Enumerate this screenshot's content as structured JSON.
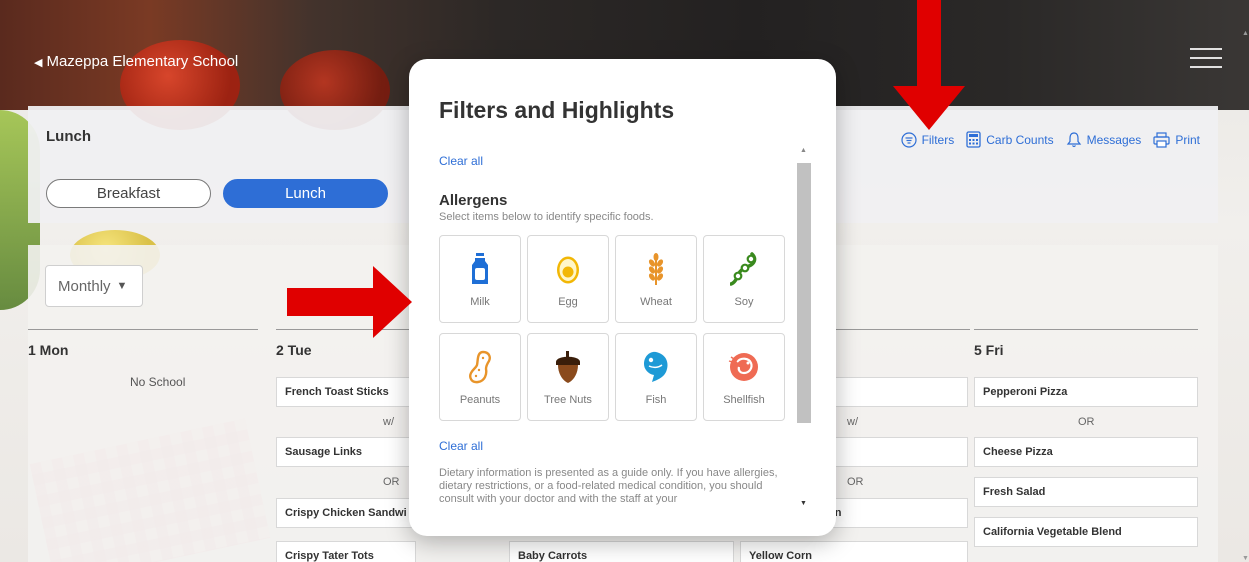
{
  "header": {
    "back_label": "Mazeppa Elementary School"
  },
  "meal": {
    "title": "Lunch",
    "tabs": [
      {
        "label": "Breakfast",
        "active": false
      },
      {
        "label": "Lunch",
        "active": true
      }
    ],
    "actions": [
      {
        "label": "Filters",
        "icon": "filter-icon"
      },
      {
        "label": "Carb Counts",
        "icon": "calculator-icon"
      },
      {
        "label": "Messages",
        "icon": "bell-icon"
      },
      {
        "label": "Print",
        "icon": "printer-icon"
      }
    ]
  },
  "calendar": {
    "view_select": "Monthly",
    "days": [
      "1 Mon",
      "2 Tue",
      "5 Fri"
    ],
    "no_school": "No School",
    "tue_items": [
      "French Toast Sticks",
      "Sausage Links",
      "Crispy Chicken Sandwi",
      "Crispy Tater Tots"
    ],
    "tue_connectors": [
      "w/",
      "OR"
    ],
    "wed_items": [
      "Baby Carrots"
    ],
    "thu_items": [
      "un",
      "Yellow Corn"
    ],
    "thu_connectors": [
      "w/",
      "OR"
    ],
    "fri_items": [
      "Pepperoni Pizza",
      "Cheese Pizza",
      "Fresh Salad",
      "California Vegetable Blend"
    ],
    "fri_connectors": [
      "OR"
    ]
  },
  "modal": {
    "title": "Filters and Highlights",
    "clear_all": "Clear all",
    "allergens_title": "Allergens",
    "allergens_subtitle": "Select items below to identify specific foods.",
    "allergens": [
      {
        "label": "Milk",
        "icon": "milk-icon",
        "color": "#1f6fd6"
      },
      {
        "label": "Egg",
        "icon": "egg-icon",
        "color": "#f2b705"
      },
      {
        "label": "Wheat",
        "icon": "wheat-icon",
        "color": "#e8942a"
      },
      {
        "label": "Soy",
        "icon": "soy-icon",
        "color": "#3a8a1e"
      },
      {
        "label": "Peanuts",
        "icon": "peanut-icon",
        "color": "#e8942a"
      },
      {
        "label": "Tree Nuts",
        "icon": "acorn-icon",
        "color": "#6b3a12"
      },
      {
        "label": "Fish",
        "icon": "fish-icon",
        "color": "#1e9ad6"
      },
      {
        "label": "Shellfish",
        "icon": "shrimp-icon",
        "color": "#ef6b54"
      }
    ],
    "clear_all_2": "Clear all",
    "disclaimer": "Dietary information is presented as a guide only. If you have allergies, dietary restrictions, or a food-related medical condition, you should consult with your doctor and with the staff at your"
  },
  "colors": {
    "accent": "#2e6ed6",
    "arrow": "#e00000"
  }
}
